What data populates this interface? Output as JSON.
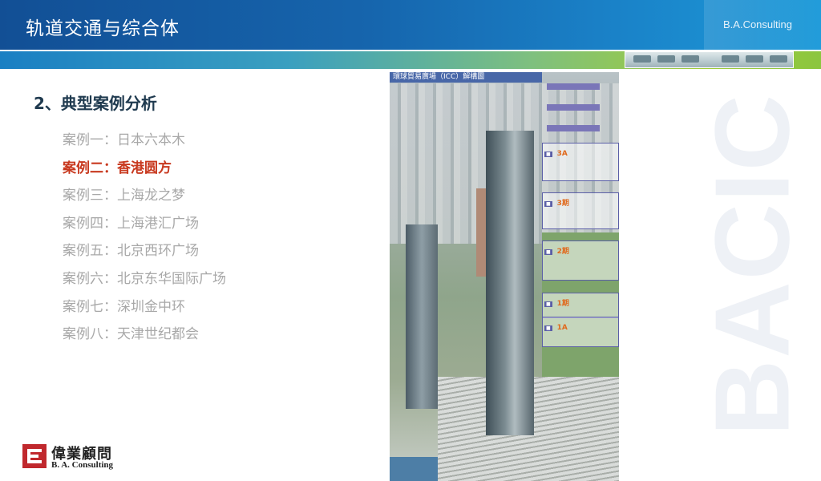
{
  "header": {
    "title": "轨道交通与综合体",
    "brand": "B.A.Consulting"
  },
  "section": {
    "title": "2、典型案例分析"
  },
  "cases": [
    {
      "label": "案例一：日本六本木",
      "active": false
    },
    {
      "label": "案例二：香港圆方",
      "active": true
    },
    {
      "label": "案例三：上海龙之梦",
      "active": false
    },
    {
      "label": "案例四：上海港汇广场",
      "active": false
    },
    {
      "label": "案例五：北京西环广场",
      "active": false
    },
    {
      "label": "案例六：北京东华国际广场",
      "active": false
    },
    {
      "label": "案例七：深圳金中环",
      "active": false
    },
    {
      "label": "案例八：天津世纪都会",
      "active": false
    }
  ],
  "photo": {
    "caption": "環球貿易廣場（ICC）解構圖",
    "phases": [
      "3A",
      "3期",
      "2期",
      "1期",
      "1A"
    ]
  },
  "watermark": "BACIC",
  "logo": {
    "cn": "偉業顧問",
    "en": "B. A. Consulting"
  },
  "colors": {
    "header_blue": "#124f95",
    "accent_green": "#8cc63f",
    "active_red": "#c8391f",
    "muted_gray": "#a8a8a8"
  }
}
